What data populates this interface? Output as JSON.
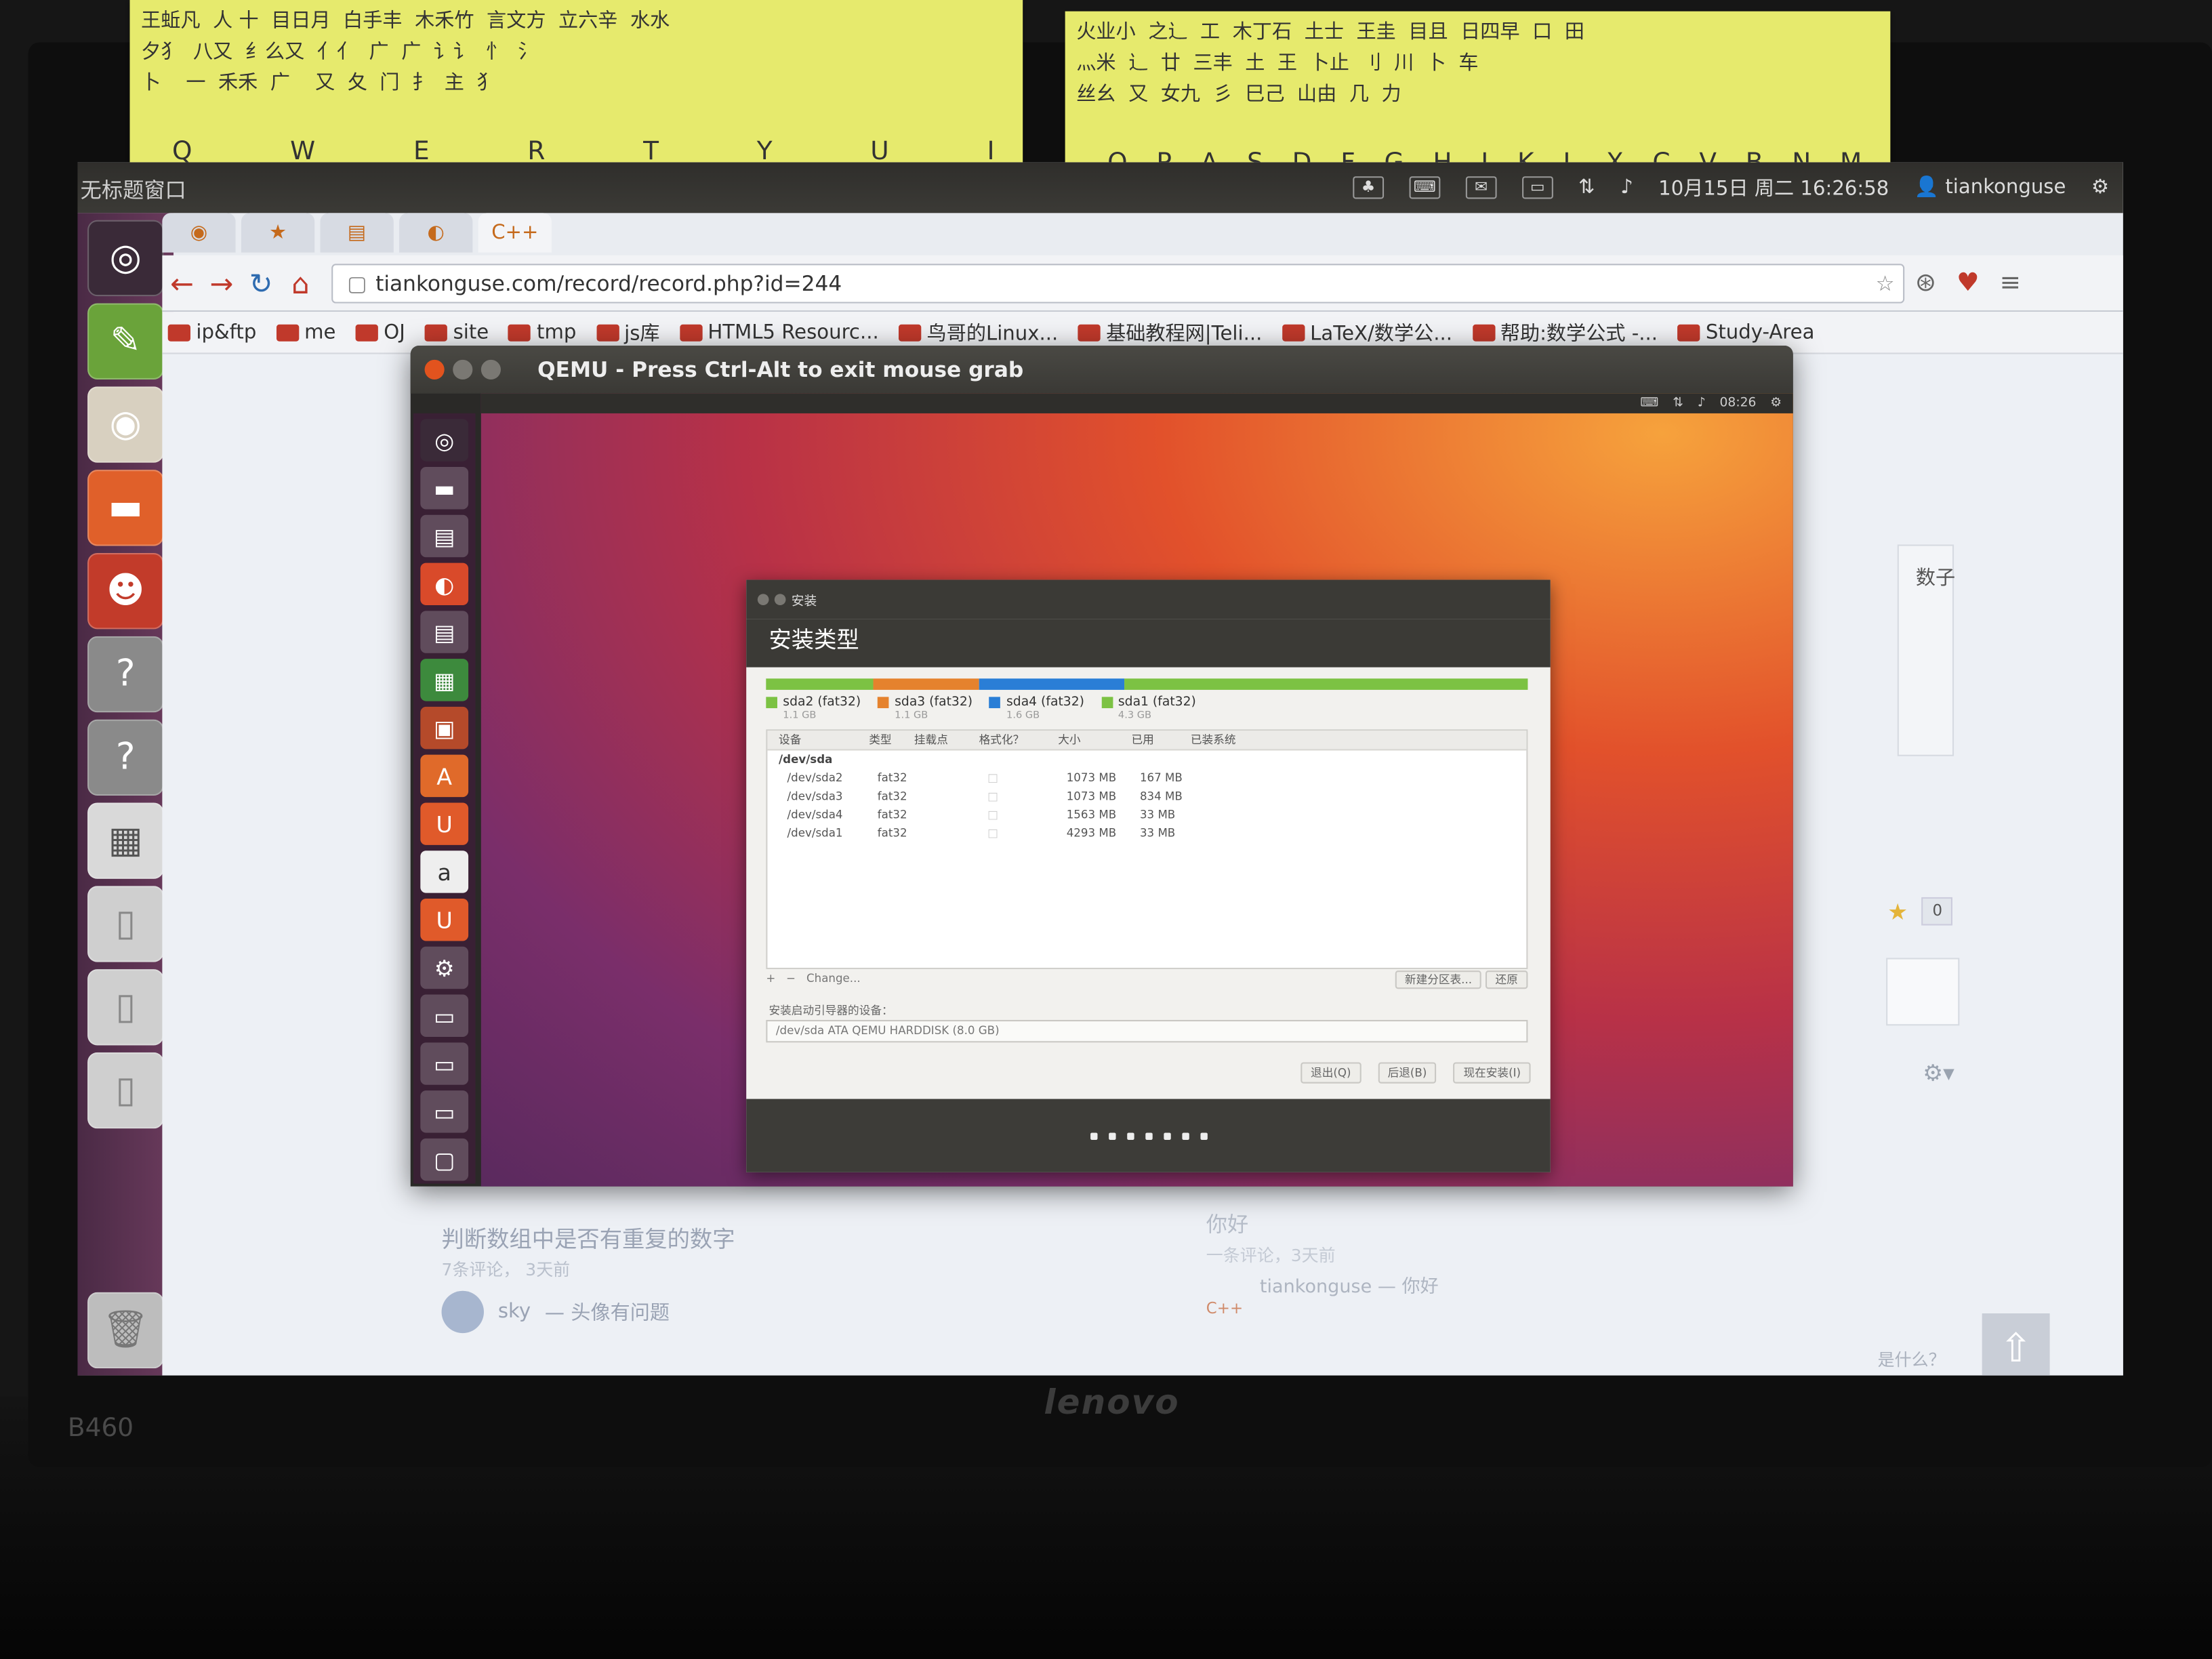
{
  "sticky_notes": {
    "left": {
      "scribbles": "王蚯凡  人 十  目日月  白手丰  木禾竹  言文方  立六辛  水水\n夕犭  八又  纟么又  亻亻  广  广  讠讠  忄  氵\n卜    一  禾禾  广    又  夂  门  扌  主  犭",
      "keys": [
        "Q",
        "W",
        "E",
        "R",
        "T",
        "Y",
        "U",
        "I"
      ]
    },
    "right": {
      "scribbles": "火业小  之辶  工  木丁石  土士  王圭  目且  日四早  口  田\n灬米  辶  廿  三丰  土  王  卜止  刂  川  卜  车\n丝幺  又  女九  彡  巳己  山由  几  力",
      "keys": [
        "O",
        "P",
        "A",
        "S",
        "D",
        "F",
        "G",
        "H",
        "J",
        "K",
        "L",
        "X",
        "C",
        "V",
        "B",
        "N",
        "M"
      ]
    }
  },
  "desktop": {
    "window_title": "无标题窗口",
    "indicators": {
      "datetime": "10月15日 周二 16:26:58",
      "user": "tiankonguse"
    }
  },
  "launcher": {
    "items": [
      {
        "icon": "ubuntu-dash-icon"
      },
      {
        "icon": "gedit-icon"
      },
      {
        "icon": "chrome-icon"
      },
      {
        "icon": "files-icon"
      },
      {
        "icon": "qq-icon"
      },
      {
        "icon": "unknown-app-icon"
      },
      {
        "icon": "unknown-app-icon"
      },
      {
        "icon": "workspace-switcher-icon"
      },
      {
        "icon": "usb-drive-icon"
      },
      {
        "icon": "usb-drive-icon"
      },
      {
        "icon": "usb-drive-icon"
      },
      {
        "icon": "trash-icon"
      }
    ]
  },
  "browser": {
    "url": "tiankonguse.com/record/record.php?id=244",
    "bookmarks": [
      "ip&ftp",
      "me",
      "OJ",
      "site",
      "tmp",
      "js库",
      "HTML5 Resourc...",
      "鸟哥的Linux...",
      "基础教程网|Teli...",
      "LaTeX/数学公...",
      "帮助:数学公式 -...",
      "Study-Area"
    ],
    "underlay": {
      "side_word": "数子",
      "star_count": "0",
      "post_title": "判断数组中是否有重复的数字",
      "post_meta": "7条评论，  3天前",
      "comment_author": "sky",
      "comment_text": "— 头像有问题",
      "right_title": "你好",
      "right_meta": "一条评论，3天前",
      "right_comment": "tiankonguse — 你好",
      "right_tag": "C++",
      "whatis": "是什么？"
    }
  },
  "qemu": {
    "title": "QEMU - Press Ctrl-Alt to exit mouse grab",
    "guest_clock": "08:26",
    "installer": {
      "header": "安装",
      "title": "安装类型",
      "bar_colors": [
        "#7cc243",
        "#e5822d",
        "#2a7ed6",
        "#7cc243"
      ],
      "bar_fractions": [
        0.14,
        0.14,
        0.19,
        0.53
      ],
      "legend": [
        {
          "name": "sda2 (fat32)",
          "size": "1.1 GB",
          "color": "#7cc243"
        },
        {
          "name": "sda3 (fat32)",
          "size": "1.1 GB",
          "color": "#e5822d"
        },
        {
          "name": "sda4 (fat32)",
          "size": "1.6 GB",
          "color": "#2a7ed6"
        },
        {
          "name": "sda1 (fat32)",
          "size": "4.3 GB",
          "color": "#7cc243"
        }
      ],
      "columns": [
        "设备",
        "类型",
        "挂载点",
        "格式化？",
        "大小",
        "已用",
        "已装系统"
      ],
      "disk": "/dev/sda",
      "rows": [
        {
          "dev": "/dev/sda2",
          "type": "fat32",
          "size": "1073 MB",
          "used": "167 MB"
        },
        {
          "dev": "/dev/sda3",
          "type": "fat32",
          "size": "1073 MB",
          "used": "834 MB"
        },
        {
          "dev": "/dev/sda4",
          "type": "fat32",
          "size": "1563 MB",
          "used": "33 MB"
        },
        {
          "dev": "/dev/sda1",
          "type": "fat32",
          "size": "4293 MB",
          "used": "33 MB"
        }
      ],
      "tools": {
        "add": "+",
        "remove": "−",
        "change": "Change...",
        "new_table": "新建分区表...",
        "revert": "还原"
      },
      "boot_label": "安装启动引导器的设备：",
      "boot_device": "/dev/sda   ATA QEMU HARDDISK (8.0 GB)",
      "buttons": {
        "quit": "退出(Q)",
        "back": "后退(B)",
        "install": "现在安装(I)"
      }
    }
  },
  "laptop": {
    "brand": "lenovo",
    "model": "B460"
  }
}
